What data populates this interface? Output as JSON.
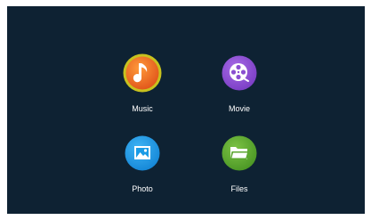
{
  "menu": {
    "items": [
      {
        "label": "Music",
        "icon": "music-note-icon",
        "color": "#f07a1e",
        "selected": true
      },
      {
        "label": "Movie",
        "icon": "film-reel-icon",
        "color": "#8a4fd0",
        "selected": false
      },
      {
        "label": "Photo",
        "icon": "picture-icon",
        "color": "#1a9be6",
        "selected": false
      },
      {
        "label": "Files",
        "icon": "folder-icon",
        "color": "#5aa62e",
        "selected": false
      }
    ]
  },
  "theme": {
    "background": "#0e2233",
    "highlight_ring": "#c8c21e"
  }
}
